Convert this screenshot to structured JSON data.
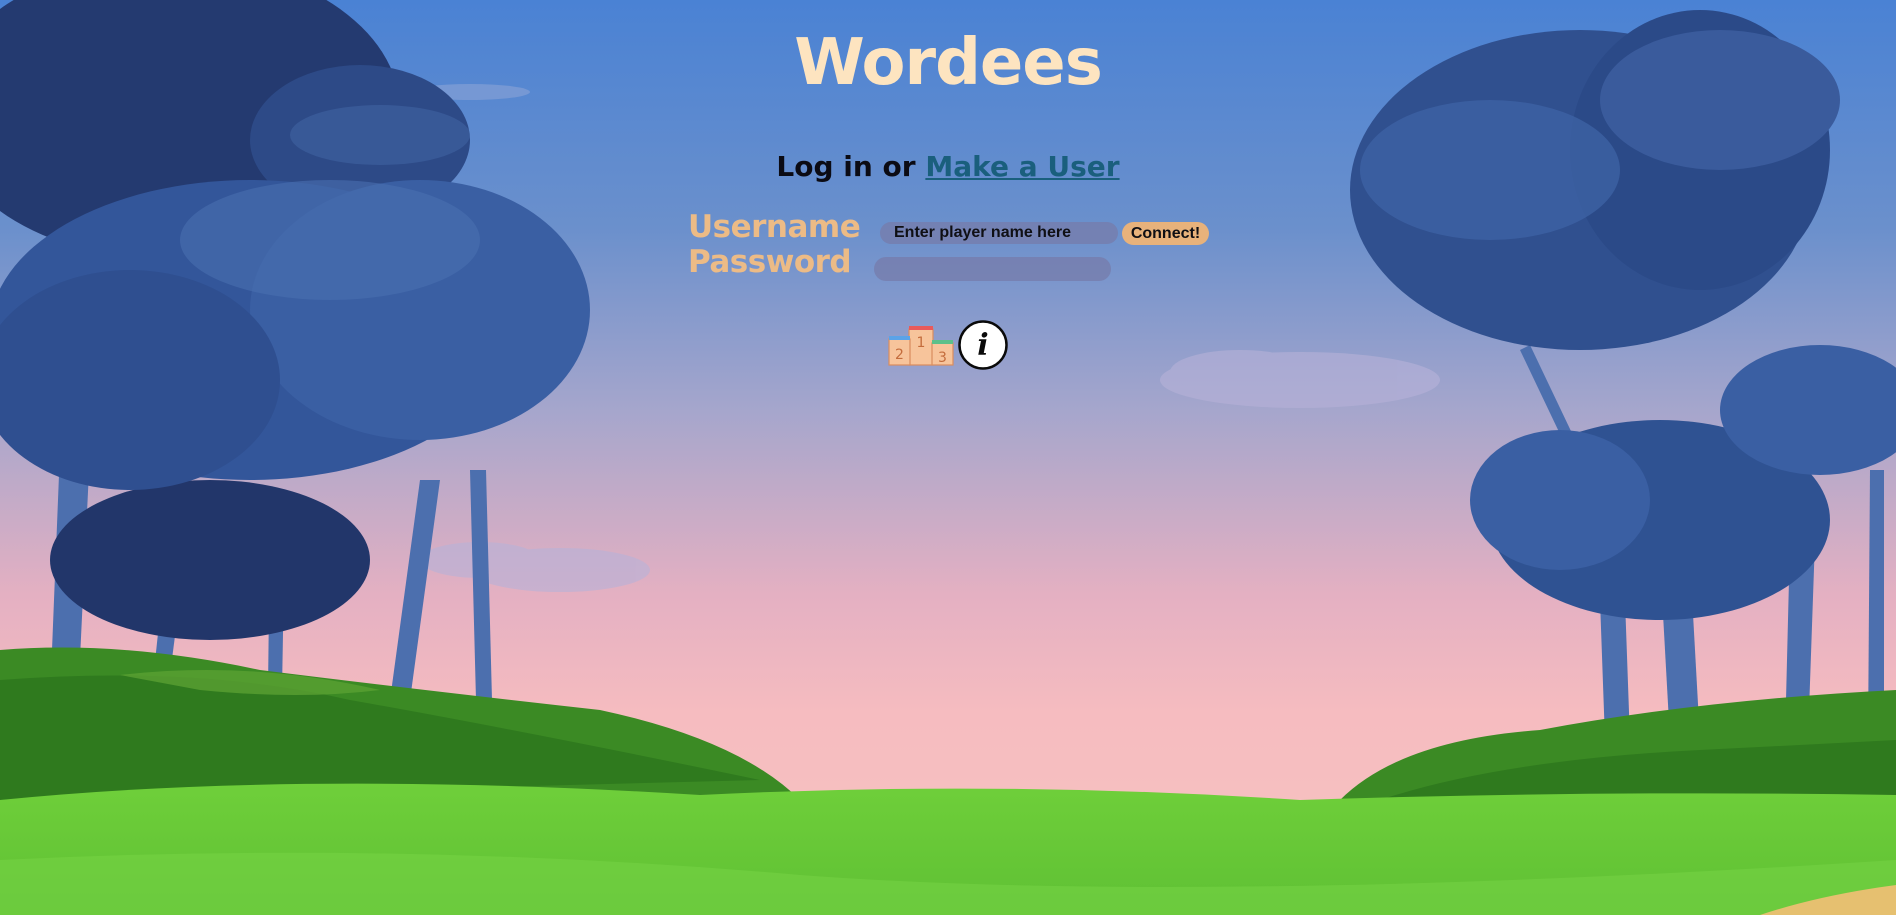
{
  "app": {
    "title": "Wordees"
  },
  "login": {
    "prefix": "Log in or ",
    "make_user_link": "Make a User",
    "username_label": "Username",
    "username_placeholder": "Enter player name here",
    "password_label": "Password",
    "password_value": "",
    "connect_label": "Connect!"
  },
  "icons": {
    "leaderboard": "podium-icon",
    "podium_places": [
      "2",
      "1",
      "3"
    ],
    "info": "info-icon",
    "info_glyph": "i"
  },
  "colors": {
    "title": "#fde4c0",
    "label": "#ecbb86",
    "link": "#1a5f7d",
    "button": "#e8b27b"
  }
}
